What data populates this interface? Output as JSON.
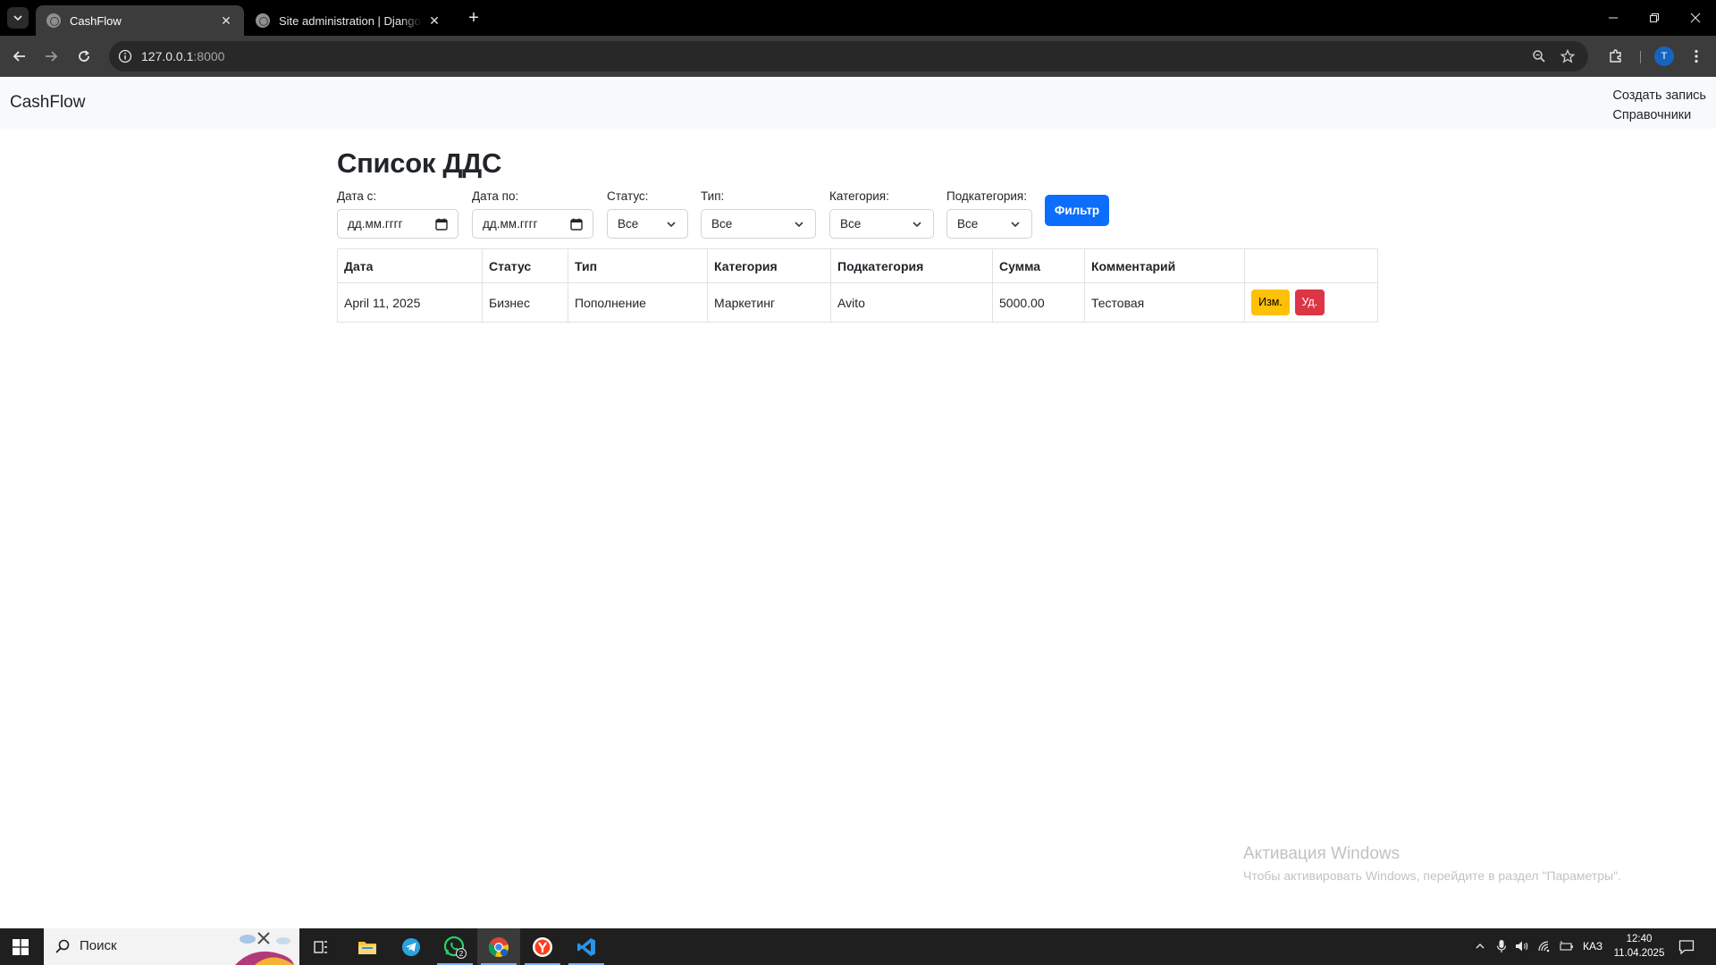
{
  "browser": {
    "tabs": [
      {
        "title": "CashFlow",
        "active": true
      },
      {
        "title": "Site administration | Django site admin",
        "active": false
      }
    ],
    "url_host": "127.0.0.1",
    "url_port": ":8000",
    "profile_initial": "T"
  },
  "navbar": {
    "brand": "CashFlow",
    "links": [
      "Создать запись",
      "Справочники"
    ]
  },
  "page": {
    "title": "Список ДДС"
  },
  "filters": {
    "date_from": {
      "label": "Дата с:",
      "placeholder": "дд.мм.гггг"
    },
    "date_to": {
      "label": "Дата по:",
      "placeholder": "дд.мм.гггг"
    },
    "status": {
      "label": "Статус:",
      "value": "Все"
    },
    "type": {
      "label": "Тип:",
      "value": "Все"
    },
    "category": {
      "label": "Категория:",
      "value": "Все"
    },
    "subcategory": {
      "label": "Подкатегория:",
      "value": "Все"
    },
    "submit_label": "Фильтр"
  },
  "table": {
    "headers": [
      "Дата",
      "Статус",
      "Тип",
      "Категория",
      "Подкатегория",
      "Сумма",
      "Комментарий",
      ""
    ],
    "rows": [
      {
        "date": "April 11, 2025",
        "status": "Бизнес",
        "type": "Пополнение",
        "category": "Маркетинг",
        "subcategory": "Avito",
        "amount": "5000.00",
        "comment": "Тестовая",
        "edit_label": "Изм.",
        "delete_label": "Уд."
      }
    ]
  },
  "windows_activation": {
    "title": "Активация Windows",
    "text": "Чтобы активировать Windows, перейдите в раздел \"Параметры\"."
  },
  "taskbar": {
    "search_placeholder": "Поиск",
    "whatsapp_badge": "2",
    "language": "КАЗ",
    "time": "12:40",
    "date": "11.04.2025"
  },
  "colors": {
    "primary": "#0d6efd",
    "warning": "#ffc107",
    "danger": "#dc3545",
    "navbar_bg": "#f8f9fa"
  }
}
